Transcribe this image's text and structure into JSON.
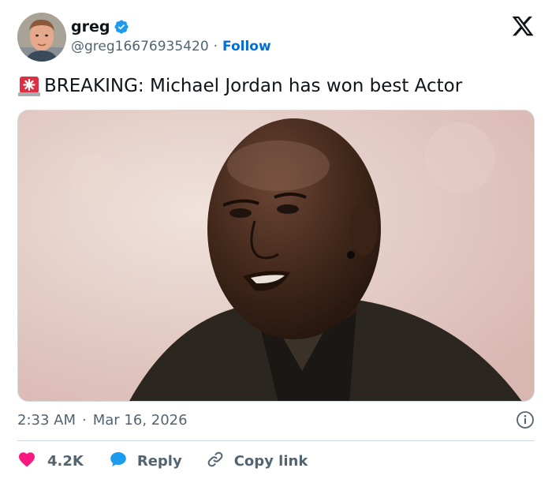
{
  "tweet": {
    "author": {
      "display_name": "greg",
      "handle": "@greg16676935420",
      "verified_icon": "verified-badge-icon",
      "follow_label": "Follow",
      "avatar": "avatar-photo"
    },
    "platform_logo": "x-logo-icon",
    "text": {
      "emoji": "siren-icon",
      "body": "BREAKING: Michael Jordan has won best Actor"
    },
    "media": {
      "kind": "photo"
    },
    "meta": {
      "time": "2:33 AM",
      "separator": "·",
      "date": "Mar 16, 2026",
      "info_icon": "info-icon"
    },
    "actions": {
      "like_count": "4.2K",
      "reply_label": "Reply",
      "copy_label": "Copy link"
    }
  },
  "colors": {
    "accent": "#1d9bf0",
    "follow": "#006fd6",
    "like": "#f91880",
    "muted": "#536471",
    "text": "#0f1419"
  }
}
